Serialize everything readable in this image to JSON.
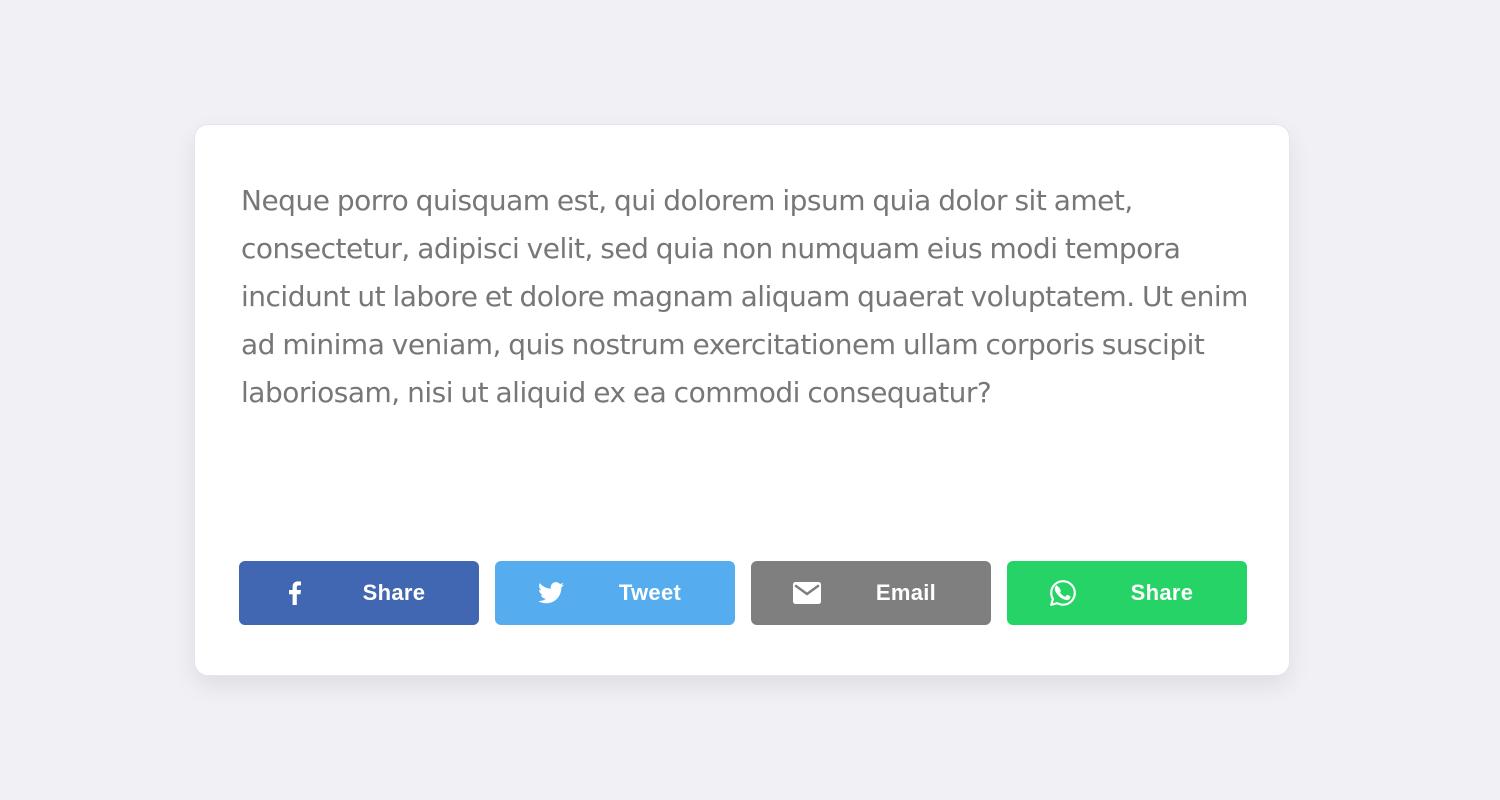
{
  "card": {
    "body_text": "Neque porro quisquam est, qui dolorem ipsum quia dolor sit amet, consectetur, adipisci velit, sed quia non numquam eius modi tempora incidunt ut labore et dolore magnam aliquam quaerat voluptatem. Ut enim ad minima veniam, quis nostrum exercitationem ullam corporis suscipit laboriosam, nisi ut aliquid ex ea commodi consequatur?"
  },
  "share_buttons": [
    {
      "label": "Share",
      "icon": "facebook-icon",
      "color": "#4267b2"
    },
    {
      "label": "Tweet",
      "icon": "twitter-icon",
      "color": "#55acee"
    },
    {
      "label": "Email",
      "icon": "email-icon",
      "color": "#7f7f7f"
    },
    {
      "label": "Share",
      "icon": "whatsapp-icon",
      "color": "#25d366"
    }
  ],
  "colors": {
    "page_background": "#f0f0f5",
    "card_background": "#ffffff",
    "body_text": "#777777"
  }
}
